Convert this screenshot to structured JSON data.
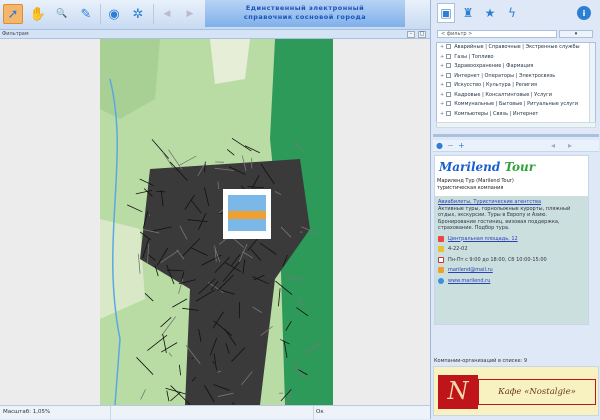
{
  "toolbar": {
    "tools": [
      {
        "icon": "pointer-icon",
        "glyph": "➚",
        "active": true
      },
      {
        "icon": "hand-pan-icon",
        "glyph": "✋"
      },
      {
        "icon": "zoom-icon",
        "glyph": "🔍"
      },
      {
        "icon": "ruler-icon",
        "glyph": "✎"
      },
      {
        "icon": "globe-icon",
        "glyph": "◉"
      },
      {
        "icon": "settings-icon",
        "glyph": "✲"
      },
      {
        "icon": "back-arrow-icon",
        "glyph": "◀"
      },
      {
        "icon": "forward-arrow-icon",
        "glyph": "▶"
      }
    ],
    "banner_line1": "Единственный электронный",
    "banner_line2": "справочник сосновой города"
  },
  "subbar": {
    "label": "Фильтрам"
  },
  "status": {
    "scale": "Масштаб: 1,05%",
    "ok": "Ок"
  },
  "right": {
    "tabs": [
      {
        "icon": "directory-icon",
        "glyph": "▣"
      },
      {
        "icon": "people-icon",
        "glyph": "♜"
      },
      {
        "icon": "star-icon",
        "glyph": "★"
      },
      {
        "icon": "lightning-icon",
        "glyph": "ϟ"
      }
    ],
    "info_icon": "i",
    "dropdown_value": "< фильтр >",
    "dropdown_button": "▾",
    "categories": [
      "Аварийные | Справочные | Экстренные службы",
      "Газы | Топливо",
      "Здравоохранение | Фармация",
      "Интернет | Операторы | Электросвязь",
      "Искусство | Культура | Религия",
      "Кадровые | Консалтинговые | Услуги",
      "Коммунальные | Бытовые | Ритуальные услуги",
      "Компьютеры | Связь | Интернет"
    ],
    "card": {
      "logo_main": "Marilend",
      "logo_accent": "Tour",
      "title": "Мариленд Тур (Marilend Tour)",
      "subtitle": "туристическая компания",
      "categories_link": "Авиабилеты, Туристические агентства",
      "description": "Активные туры, горнолыжные курорты, пляжный отдых, экскурсии. Туры в Европу и Азию. Бронирование гостиниц, визовая поддержка, страхование. Подбор тура.",
      "address": "Центральная площадь, 12",
      "phone": "4-22-02",
      "hours": "Пн-Пт с 9:00 до 18:00, Сб 10:00-15:00",
      "email": "marilend@mail.ru",
      "website": "www.marilend.ru"
    },
    "count_label": "Компании-организаций в списке: 9",
    "ad": {
      "letter": "N",
      "text": "Кафе «Nostalgie»"
    }
  },
  "colors": {
    "accent": "#2d7fd6",
    "map_green": "#2e9a5a",
    "map_light": "#b9dca4"
  }
}
